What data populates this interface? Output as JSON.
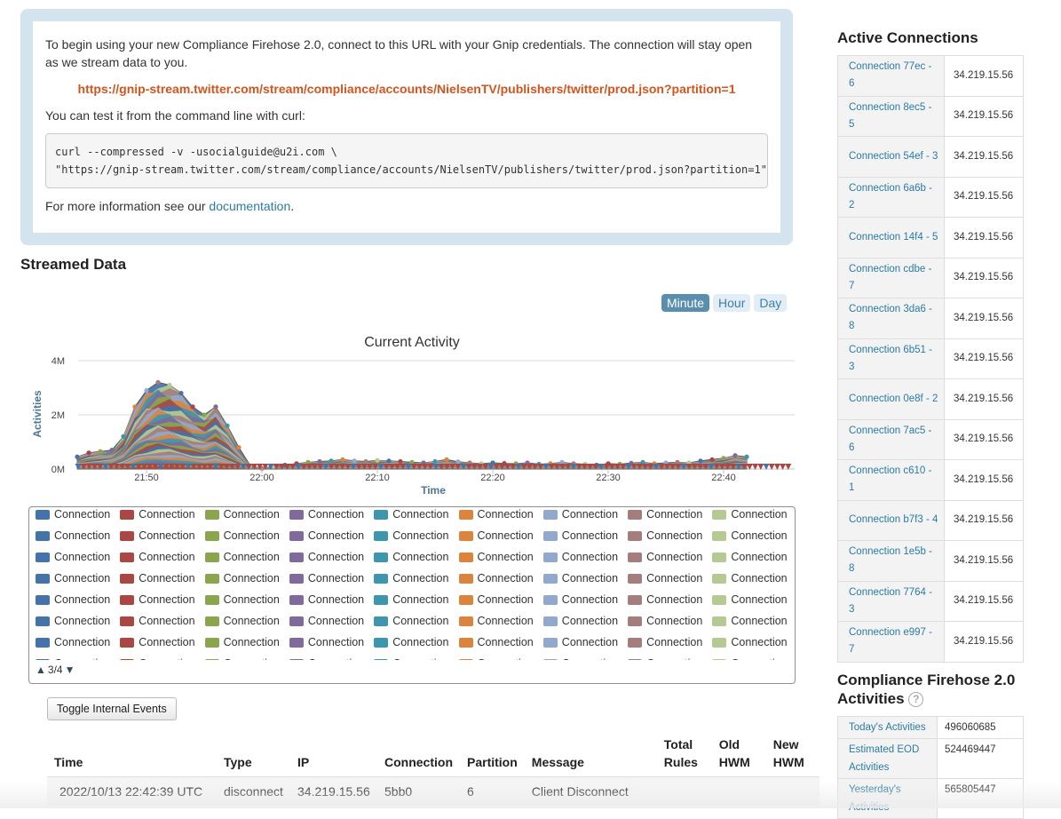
{
  "info": {
    "intro": "To begin using your new Compliance Firehose 2.0, connect to this URL with your Gnip credentials. The connection will stay open as we stream data to you.",
    "stream_url": "https://gnip-stream.twitter.com/stream/compliance/accounts/NielsenTV/publishers/twitter/prod.json?partition=1",
    "curl_intro": "You can test it from the command line with curl:",
    "curl_line1": "curl --compressed -v -usocialguide@u2i.com \\",
    "curl_line2": "\"https://gnip-stream.twitter.com/stream/compliance/accounts/NielsenTV/publishers/twitter/prod.json?partition=1\"",
    "more_info_prefix": "For more information see our ",
    "documentation_link": "documentation",
    "more_info_suffix": "."
  },
  "streamed": {
    "title": "Streamed Data",
    "ranges": [
      "Minute",
      "Hour",
      "Day"
    ],
    "active_range": "Minute"
  },
  "chart_data": {
    "type": "area",
    "title": "Current Activity",
    "xlabel": "Time",
    "ylabel": "Activities",
    "x_ticks": [
      "21:50",
      "22:00",
      "22:10",
      "22:20",
      "22:30",
      "22:40"
    ],
    "y_ticks": [
      "0M",
      "2M",
      "4M"
    ],
    "ylim": [
      0,
      4000000
    ],
    "stacked": true,
    "grid": true,
    "total_series": [
      [
        "21:44",
        450000
      ],
      [
        "21:45",
        600000
      ],
      [
        "21:46",
        650000
      ],
      [
        "21:47",
        700000
      ],
      [
        "21:48",
        1200000
      ],
      [
        "21:49",
        2300000
      ],
      [
        "21:50",
        2900000
      ],
      [
        "21:51",
        3200000
      ],
      [
        "21:52",
        3100000
      ],
      [
        "21:53",
        2800000
      ],
      [
        "21:54",
        2300000
      ],
      [
        "21:55",
        2000000
      ],
      [
        "21:56",
        2300000
      ],
      [
        "21:57",
        1600000
      ],
      [
        "21:58",
        800000
      ],
      [
        "21:59",
        120000
      ],
      [
        "22:00",
        20000
      ],
      [
        "22:01",
        100000
      ],
      [
        "22:02",
        150000
      ],
      [
        "22:03",
        200000
      ],
      [
        "22:04",
        250000
      ],
      [
        "22:05",
        280000
      ],
      [
        "22:06",
        300000
      ],
      [
        "22:07",
        350000
      ],
      [
        "22:08",
        300000
      ],
      [
        "22:09",
        280000
      ],
      [
        "22:10",
        320000
      ],
      [
        "22:11",
        300000
      ],
      [
        "22:12",
        280000
      ],
      [
        "22:13",
        250000
      ],
      [
        "22:14",
        230000
      ],
      [
        "22:15",
        280000
      ],
      [
        "22:16",
        350000
      ],
      [
        "22:17",
        270000
      ],
      [
        "22:18",
        230000
      ],
      [
        "22:19",
        200000
      ],
      [
        "22:20",
        230000
      ],
      [
        "22:21",
        210000
      ],
      [
        "22:22",
        200000
      ],
      [
        "22:23",
        230000
      ],
      [
        "22:24",
        180000
      ],
      [
        "22:25",
        200000
      ],
      [
        "22:26",
        250000
      ],
      [
        "22:27",
        200000
      ],
      [
        "22:28",
        180000
      ],
      [
        "22:29",
        150000
      ],
      [
        "22:30",
        200000
      ],
      [
        "22:31",
        180000
      ],
      [
        "22:32",
        220000
      ],
      [
        "22:33",
        250000
      ],
      [
        "22:34",
        200000
      ],
      [
        "22:35",
        230000
      ],
      [
        "22:36",
        250000
      ],
      [
        "22:37",
        230000
      ],
      [
        "22:38",
        300000
      ],
      [
        "22:39",
        350000
      ],
      [
        "22:40",
        400000
      ],
      [
        "22:41",
        500000
      ],
      [
        "22:42",
        450000
      ]
    ],
    "band_palette": [
      "#4572A7",
      "#AA4643",
      "#89A54E",
      "#80699B",
      "#3D96AE",
      "#DB843D",
      "#92A8CD",
      "#A47D7C",
      "#B5CA92"
    ],
    "legend_page": "3/4"
  },
  "legend": {
    "label": "Connection",
    "colors": [
      "#4572A7",
      "#AA4643",
      "#89A54E",
      "#80699B",
      "#3D96AE",
      "#DB843D",
      "#92A8CD",
      "#A47D7C",
      "#B5CA92"
    ],
    "rows": 8
  },
  "toggle_label": "Toggle Internal Events",
  "events": {
    "headers": [
      "Time",
      "Type",
      "IP",
      "Connection",
      "Partition",
      "Message",
      "Total Rules",
      "Old HWM",
      "New HWM"
    ],
    "rows": [
      [
        "2022/10/13 22:42:39 UTC",
        "disconnect",
        "34.219.15.56",
        "5bb0",
        "6",
        "Client Disconnect",
        "",
        "",
        ""
      ]
    ]
  },
  "connections": {
    "title": "Active Connections",
    "items": [
      {
        "name": "Connection 77ec - 6",
        "ip": "34.219.15.56"
      },
      {
        "name": "Connection 8ec5 - 5",
        "ip": "34.219.15.56"
      },
      {
        "name": "Connection 54ef - 3",
        "ip": "34.219.15.56"
      },
      {
        "name": "Connection 6a6b - 2",
        "ip": "34.219.15.56"
      },
      {
        "name": "Connection 14f4 - 5",
        "ip": "34.219.15.56"
      },
      {
        "name": "Connection cdbe - 7",
        "ip": "34.219.15.56"
      },
      {
        "name": "Connection 3da6 - 8",
        "ip": "34.219.15.56"
      },
      {
        "name": "Connection 6b51 - 3",
        "ip": "34.219.15.56"
      },
      {
        "name": "Connection 0e8f - 2",
        "ip": "34.219.15.56"
      },
      {
        "name": "Connection 7ac5 - 6",
        "ip": "34.219.15.56"
      },
      {
        "name": "Connection c610 - 1",
        "ip": "34.219.15.56"
      },
      {
        "name": "Connection b7f3 - 4",
        "ip": "34.219.15.56"
      },
      {
        "name": "Connection 1e5b - 8",
        "ip": "34.219.15.56"
      },
      {
        "name": "Connection 7764 - 3",
        "ip": "34.219.15.56"
      },
      {
        "name": "Connection e997 - 7",
        "ip": "34.219.15.56"
      }
    ]
  },
  "activities": {
    "title": "Compliance Firehose 2.0 Activities",
    "help_icon": "?",
    "items": [
      {
        "label": "Today's Activities",
        "value": "496060685"
      },
      {
        "label": "Estimated EOD Activities",
        "value": "524469447"
      },
      {
        "label": "Yesterday's Activities",
        "value": "565805447"
      }
    ]
  }
}
